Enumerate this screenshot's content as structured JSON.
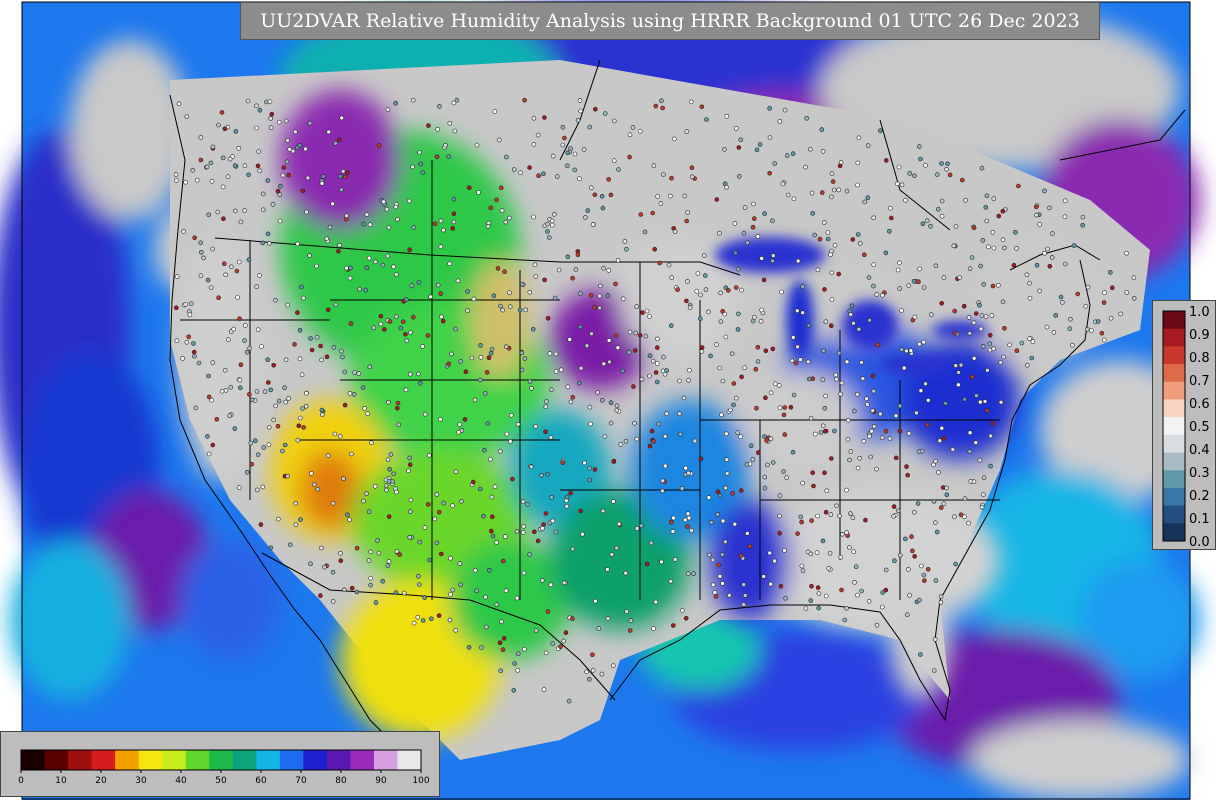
{
  "title": "UU2DVAR Relative Humidity Analysis using HRRR Background 01 UTC 26 Dec 2023",
  "colors": {
    "ocean_blue": "#1e6cf0",
    "ocean_cyan": "#12b6e6",
    "purple": "#7a1fa6",
    "deep_blue": "#1a1fd6",
    "gray_moist": "#cfcfcf",
    "green": "#2fc84a",
    "yellow": "#f5e20a",
    "orange": "#f59a0a",
    "red_dry": "#c81818",
    "panel_gray": "#bdbdbd"
  },
  "legend_right": {
    "labels": [
      "1.0",
      "0.9",
      "0.8",
      "0.7",
      "0.6",
      "0.5",
      "0.4",
      "0.3",
      "0.2",
      "0.1",
      "0.0"
    ],
    "colors": [
      "#6b0a14",
      "#a61b22",
      "#c8382e",
      "#dd6a4a",
      "#ef9d7c",
      "#f7d4c4",
      "#f3f3f3",
      "#d8dde0",
      "#a9bcc6",
      "#5f9aaa",
      "#3a76a6",
      "#234f80",
      "#17335a"
    ]
  },
  "legend_bottom": {
    "labels": [
      "0",
      "10",
      "20",
      "30",
      "40",
      "50",
      "60",
      "70",
      "80",
      "90",
      "100"
    ],
    "colors": [
      "#1a0000",
      "#5a0000",
      "#a10e0e",
      "#d61c1c",
      "#f2a000",
      "#f6e60f",
      "#c8ec1a",
      "#5ed62a",
      "#1fb84a",
      "#0aa37a",
      "#12b6e6",
      "#1e6cf0",
      "#2020d0",
      "#5a18b0",
      "#9a2ab8",
      "#d59fe0",
      "#e8e8e8"
    ]
  }
}
